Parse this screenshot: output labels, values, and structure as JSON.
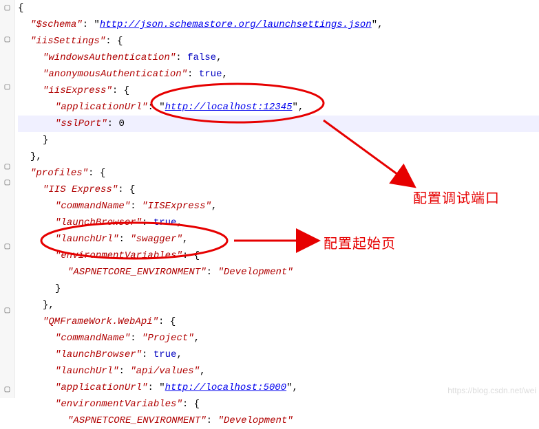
{
  "code": {
    "schema_key": "$schema",
    "schema_url": "http://json.schemastore.org/launchsettings.json",
    "iisSettings_key": "iisSettings",
    "windowsAuth_key": "windowsAuthentication",
    "windowsAuth_val": "false",
    "anonAuth_key": "anonymousAuthentication",
    "anonAuth_val": "true",
    "iisExpress_key": "iisExpress",
    "appUrl_key": "applicationUrl",
    "appUrl_val": "http://localhost:12345",
    "sslPort_key": "sslPort",
    "sslPort_val": "0",
    "profiles_key": "profiles",
    "iisExpressProfile": "IIS Express",
    "commandName_key": "commandName",
    "commandName_iis": "IISExpress",
    "launchBrowser_key": "launchBrowser",
    "launchBrowser_val": "true",
    "launchUrl_key": "launchUrl",
    "launchUrl_val": "swagger",
    "envVars_key": "environmentVariables",
    "aspnet_env_key": "ASPNETCORE_ENVIRONMENT",
    "aspnet_env_val": "Development",
    "qm_key": "QMFrameWork.WebApi",
    "commandName_proj": "Project",
    "launchUrl_api": "api/values",
    "appUrl_5000": "http://localhost:5000"
  },
  "anno": {
    "port": "配置调试端口",
    "startpage": "配置起始页"
  },
  "watermark": "https://blog.csdn.net/wei"
}
